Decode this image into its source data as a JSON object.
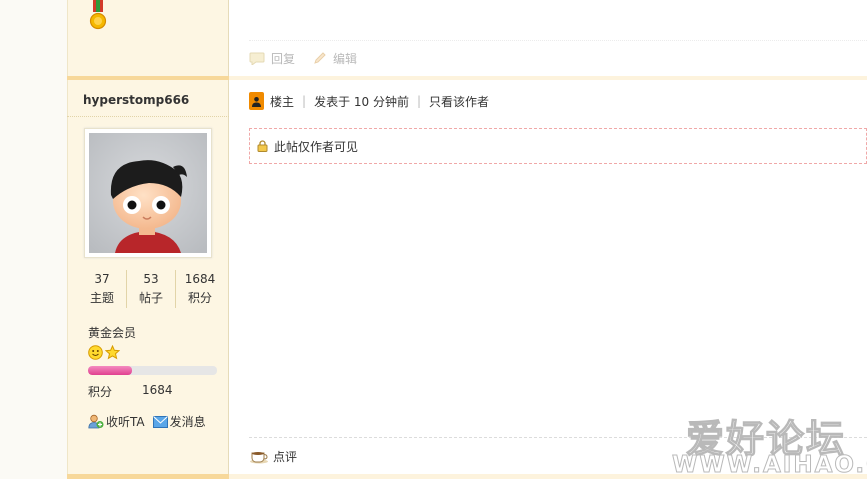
{
  "previous_post": {
    "reply_label": "回复",
    "edit_label": "编辑"
  },
  "user": {
    "name": "hyperstomp666",
    "stats": [
      {
        "value": "37",
        "label": "主题"
      },
      {
        "value": "53",
        "label": "帖子"
      },
      {
        "value": "1684",
        "label": "积分"
      }
    ],
    "group": "黄金会员",
    "progress_fraction": 0.34,
    "points_label": "积分",
    "points_value": "1684",
    "follow_label": "收听TA",
    "message_label": "发消息"
  },
  "post": {
    "author_tag": "楼主",
    "posted_time": "发表于 10 分钟前",
    "only_author_label": "只看该作者",
    "hidden_notice": "此帖仅作者可见",
    "comment_label": "点评"
  },
  "watermark": {
    "title": "爱好论坛",
    "url": "WWW.AIHAO.CC"
  },
  "colors": {
    "accent_orange": "#f08a00",
    "separator": "#f7d89a",
    "progress_pink": "#e0408f",
    "hidden_border": "#f0a8a8"
  }
}
